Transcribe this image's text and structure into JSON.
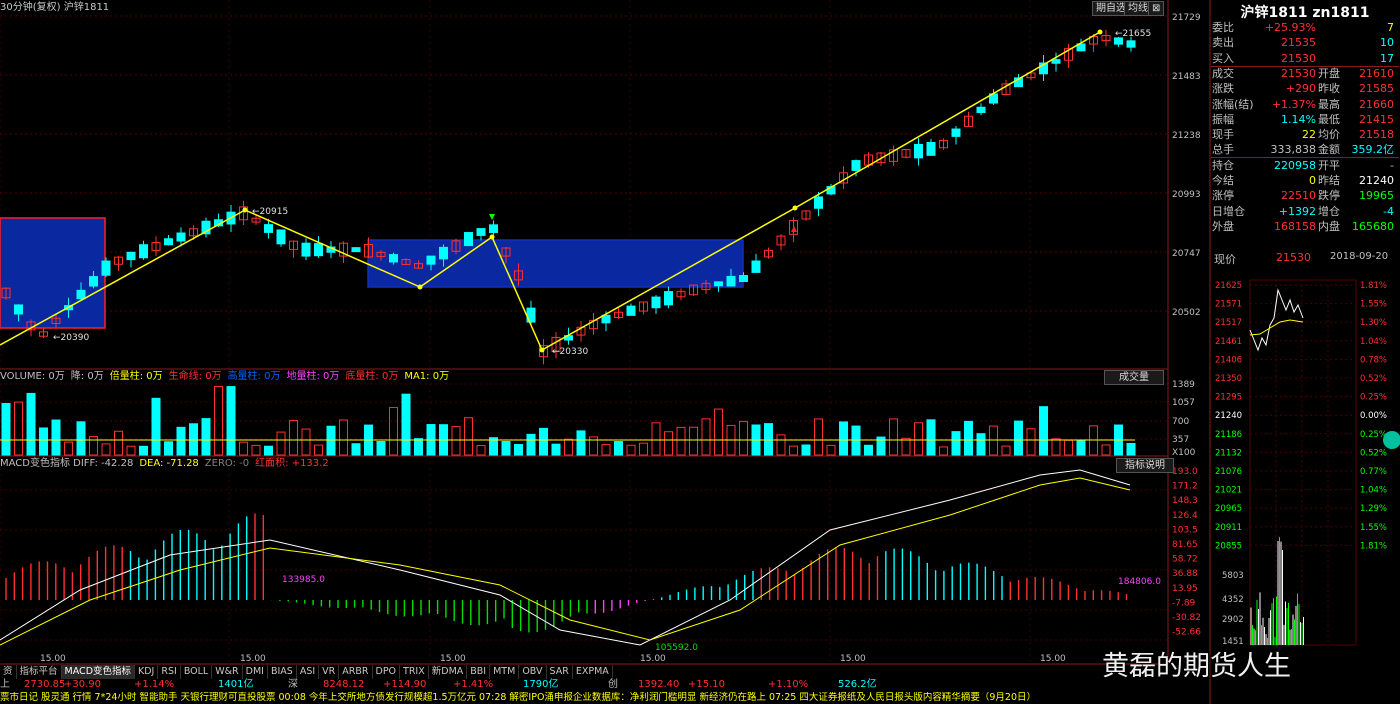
{
  "header": {
    "period_label": "30分钟(复权)",
    "symbol_label": "沪锌1811",
    "buttons": [
      "期自选",
      "均线"
    ],
    "close_symbol": "⊠"
  },
  "price_axis": [
    "21729",
    "21483",
    "21238",
    "20993",
    "20747",
    "20502"
  ],
  "price_annotations": {
    "high": "21655",
    "peak1": "20915",
    "low1": "20390",
    "low2": "20330"
  },
  "volume_panel": {
    "indicator_text": [
      {
        "label": "VOLUME: 0万",
        "color": "#c0c0c0"
      },
      {
        "label": "降: 0万",
        "color": "#c0c0c0"
      },
      {
        "label": "倍量柱: 0万",
        "color": "#ffff00"
      },
      {
        "label": "生命线: 0万",
        "color": "#ff3030"
      },
      {
        "label": "高量柱: 0万",
        "color": "#0060ff"
      },
      {
        "label": "地量柱: 0万",
        "color": "#ff40ff"
      },
      {
        "label": "底量柱: 0万",
        "color": "#ff3030"
      },
      {
        "label": "MA1: 0万",
        "color": "#ffff00"
      }
    ],
    "dropdown_label": "成交量",
    "axis": [
      "1389",
      "1057",
      "700",
      "357",
      "X100"
    ]
  },
  "macd_panel": {
    "indicator_text": [
      {
        "label": "MACD变色指标 DIFF: -42.28",
        "color": "#c0c0c0"
      },
      {
        "label": "DEA: -71.28",
        "color": "#ffff00"
      },
      {
        "label": "ZERO: -0",
        "color": "#808080"
      },
      {
        "label": "红面积: +133.2",
        "color": "#ff3030"
      }
    ],
    "help_button": "指标说明",
    "axis": [
      "193.0",
      "171.2",
      "148.3",
      "126.4",
      "103.5",
      "81.65",
      "58.72",
      "36.88",
      "13.95",
      "-7.89",
      "-30.82",
      "-52.66"
    ],
    "annotations": [
      "133985.0",
      "184806.0",
      "105592.0"
    ]
  },
  "time_axis": [
    "15.00",
    "15.00",
    "15.00",
    "15.00",
    "15.00",
    "15.00"
  ],
  "quote_panel": {
    "title": "沪锌1811 zn1811",
    "rows": [
      {
        "l1": "委比",
        "v1": "+25.93%",
        "c1": "#ff3030",
        "l2": "",
        "v2": "7",
        "c2": "#ffff00"
      },
      {
        "l1": "卖出",
        "v1": "21535",
        "c1": "#ff3030",
        "l2": "",
        "v2": "10",
        "c2": "#00ffff"
      },
      {
        "l1": "买入",
        "v1": "21530",
        "c1": "#ff3030",
        "l2": "",
        "v2": "17",
        "c2": "#00ffff"
      },
      {
        "l1": "成交",
        "v1": "21530",
        "c1": "#ff3030",
        "l2": "开盘",
        "v2": "21610",
        "c2": "#ff3030"
      },
      {
        "l1": "涨跌",
        "v1": "+290",
        "c1": "#ff3030",
        "l2": "昨收",
        "v2": "21585",
        "c2": "#ff3030"
      },
      {
        "l1": "涨幅(结)",
        "v1": "+1.37%",
        "c1": "#ff3030",
        "l2": "最高",
        "v2": "21660",
        "c2": "#ff3030"
      },
      {
        "l1": "振幅",
        "v1": "1.14%",
        "c1": "#00ffff",
        "l2": "最低",
        "v2": "21415",
        "c2": "#ff3030"
      },
      {
        "l1": "现手",
        "v1": "22",
        "c1": "#ffff00",
        "l2": "均价",
        "v2": "21518",
        "c2": "#ff3030"
      },
      {
        "l1": "总手",
        "v1": "333,838",
        "c1": "#c0c0c0",
        "l2": "金额",
        "v2": "359.2亿",
        "c2": "#00ffff"
      },
      {
        "l1": "持仓",
        "v1": "220958",
        "c1": "#00ffff",
        "l2": "开平",
        "v2": "-",
        "c2": "#c0c0c0"
      },
      {
        "l1": "今结",
        "v1": "0",
        "c1": "#ffff00",
        "l2": "昨结",
        "v2": "21240",
        "c2": "#ffffff"
      },
      {
        "l1": "涨停",
        "v1": "22510",
        "c1": "#ff3030",
        "l2": "跌停",
        "v2": "19965",
        "c2": "#00ff00"
      },
      {
        "l1": "日增仓",
        "v1": "+1392",
        "c1": "#00ffff",
        "l2": "增仓",
        "v2": "-4",
        "c2": "#00ffff"
      },
      {
        "l1": "外盘",
        "v1": "168158",
        "c1": "#ff3030",
        "l2": "内盘",
        "v2": "165680",
        "c2": "#00ff00"
      }
    ],
    "price_label": "现价",
    "price_value": "21530",
    "date": "2018-09-20",
    "mini_axis_left": [
      "21625",
      "21571",
      "21517",
      "21461",
      "21406",
      "21350",
      "21295",
      "21240",
      "21186",
      "21132",
      "21076",
      "21021",
      "20965",
      "20911",
      "20855"
    ],
    "mini_axis_right": [
      "1.81%",
      "1.55%",
      "1.30%",
      "1.04%",
      "0.78%",
      "0.52%",
      "0.25%",
      "0.00%",
      "0.25%",
      "0.52%",
      "0.77%",
      "1.04%",
      "1.29%",
      "1.55%",
      "1.81%"
    ],
    "mini_vol_axis": [
      "5803",
      "4352",
      "2902",
      "1451"
    ]
  },
  "bottom_tabs": [
    "资",
    "指标平台",
    "MACD变色指标",
    "KDJ",
    "RSI",
    "BOLL",
    "W&R",
    "DMI",
    "BIAS",
    "ASI",
    "VR",
    "ARBR",
    "DPO",
    "TRIX",
    "新DMA",
    "BBI",
    "MTM",
    "OBV",
    "SAR",
    "EXPMA"
  ],
  "status_bar": [
    {
      "text": "上",
      "color": "#c0c0c0"
    },
    {
      "text": "2730.85",
      "color": "#ff3030"
    },
    {
      "text": "+30.90",
      "color": "#ff3030"
    },
    {
      "text": "+1.14%",
      "color": "#ff3030"
    },
    {
      "text": "1401亿",
      "color": "#00ffff"
    },
    {
      "text": "深",
      "color": "#c0c0c0"
    },
    {
      "text": "8248.12",
      "color": "#ff3030"
    },
    {
      "text": "+114.90",
      "color": "#ff3030"
    },
    {
      "text": "+1.41%",
      "color": "#ff3030"
    },
    {
      "text": "1790亿",
      "color": "#00ffff"
    },
    {
      "text": "创",
      "color": "#c0c0c0"
    },
    {
      "text": "1392.40",
      "color": "#ff3030"
    },
    {
      "text": "+15.10",
      "color": "#ff3030"
    },
    {
      "text": "+1.10%",
      "color": "#ff3030"
    },
    {
      "text": "526.2亿",
      "color": "#00ffff"
    }
  ],
  "ticker": "票市日记  股灵通  行情  7*24小时  智能助手  天银行理财可直投股票    00:08 今年上交所地方债发行规模超1.5万亿元    07:28 解密IPO涌申报企业数据库：净利润门槛明显 新经济仍在路上    07:25 四大证券报纸及人民日报头版内容精华摘要（9月20日）",
  "watermark": "黄磊的期货人生",
  "colors": {
    "up": "#ff3030",
    "down": "#00ffff",
    "trend": "#ffff00",
    "box_fill": "#0a28a0",
    "box_border": "#1030c0",
    "red_box": "#ff2020"
  }
}
